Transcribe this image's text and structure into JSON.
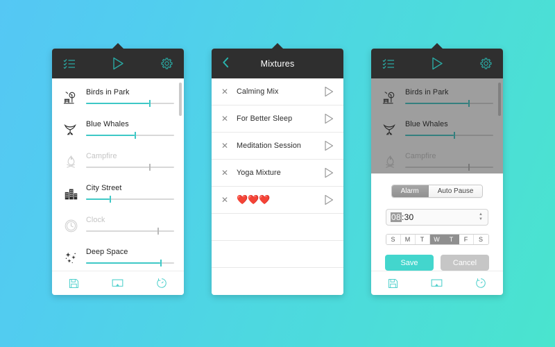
{
  "background": {
    "gradient_start": "#55c7f4",
    "gradient_end": "#4ae4ce"
  },
  "theme": {
    "accent": "#3ec8c6",
    "header_bg": "#2f2f2f",
    "header_icon": "#2aa9a3",
    "footer_icon": "#4fd0cc",
    "disabled": "#c4c4c4"
  },
  "panel_sounds": {
    "header": {
      "mixtures_icon": "checklist-icon",
      "play_icon": "play-icon",
      "settings_icon": "gear-icon"
    },
    "sounds": [
      {
        "name": "Birds in Park",
        "icon": "tree-bench-icon",
        "active": true,
        "volume": 72
      },
      {
        "name": "Blue Whales",
        "icon": "whale-tail-icon",
        "active": true,
        "volume": 55
      },
      {
        "name": "Campfire",
        "icon": "campfire-icon",
        "active": false,
        "volume": 72
      },
      {
        "name": "City Street",
        "icon": "buildings-icon",
        "active": true,
        "volume": 27
      },
      {
        "name": "Clock",
        "icon": "clock-icon",
        "active": false,
        "volume": 81
      },
      {
        "name": "Deep Space",
        "icon": "sparkles-icon",
        "active": true,
        "volume": 84
      }
    ],
    "footer": {
      "save_icon": "floppy-save-icon",
      "cast_icon": "cast-screen-icon",
      "timer_icon": "timer-icon"
    }
  },
  "panel_mixtures": {
    "header": {
      "back_icon": "chevron-left-icon",
      "title": "Mixtures"
    },
    "rows": [
      {
        "name": "Calming Mix",
        "close_icon": "close-icon",
        "play_icon": "play-icon"
      },
      {
        "name": "For Better Sleep",
        "close_icon": "close-icon",
        "play_icon": "play-icon"
      },
      {
        "name": "Meditation Session",
        "close_icon": "close-icon",
        "play_icon": "play-icon"
      },
      {
        "name": "Yoga Mixture",
        "close_icon": "close-icon",
        "play_icon": "play-icon"
      },
      {
        "name": "❤️❤️❤️",
        "close_icon": "close-icon",
        "play_icon": "play-icon"
      }
    ],
    "empty_rows": 3
  },
  "panel_alarm": {
    "dialog": {
      "tabs": [
        {
          "label": "Alarm",
          "active": true
        },
        {
          "label": "Auto Pause",
          "active": false
        }
      ],
      "time": {
        "hours": "08",
        "separator_minutes": ":30",
        "spinner_up": "▲",
        "spinner_down": "▼"
      },
      "days": [
        {
          "label": "S",
          "on": false
        },
        {
          "label": "M",
          "on": false
        },
        {
          "label": "T",
          "on": false
        },
        {
          "label": "W",
          "on": true
        },
        {
          "label": "T",
          "on": true
        },
        {
          "label": "F",
          "on": false
        },
        {
          "label": "S",
          "on": false
        }
      ],
      "save_label": "Save",
      "cancel_label": "Cancel"
    }
  }
}
